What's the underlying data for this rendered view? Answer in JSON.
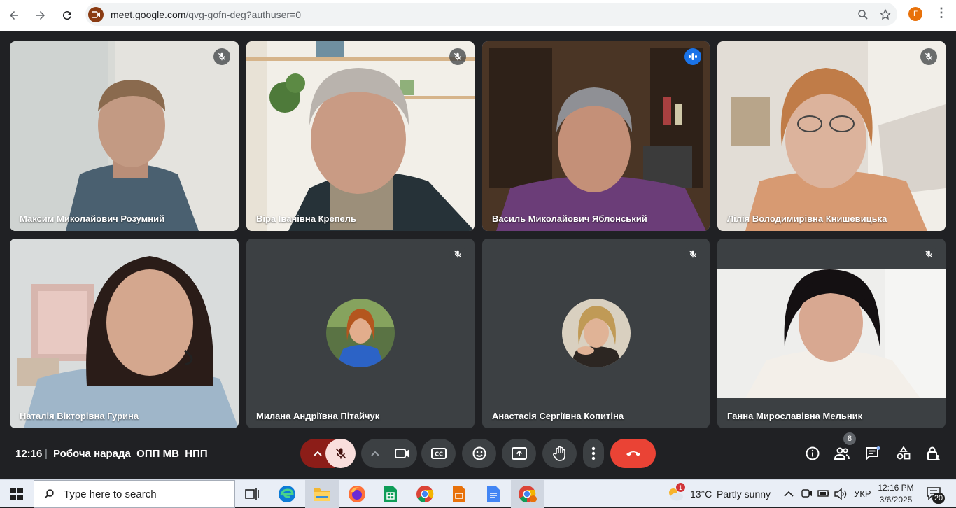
{
  "browser": {
    "url_host": "meet.google.com",
    "url_path": "/qvg-gofn-deg?authuser=0",
    "profile_initial": "Г"
  },
  "participants": [
    {
      "name": "Максим Миколайович Розумний",
      "muted": true
    },
    {
      "name": "Віра Іванівна Крепель",
      "muted": true
    },
    {
      "name": "Василь Миколайович Яблонський",
      "speaking": true
    },
    {
      "name": "Лілія Володимирівна Книшевицька",
      "muted": true
    },
    {
      "name": "Наталія Вікторівна Гурина",
      "muted": false
    },
    {
      "name": "Милана Андріївна Пітайчук",
      "muted": true
    },
    {
      "name": "Анастасія Сергіївна Копитіна",
      "muted": true
    },
    {
      "name": "Ганна Мирославівна Мельник",
      "muted": true
    }
  ],
  "meeting": {
    "time": "12:16",
    "separator": "|",
    "title": "Робоча нарада_ОПП МВ_НПП",
    "participant_count": "8"
  },
  "taskbar": {
    "search_placeholder": "Type here to search",
    "weather_temp": "13°C",
    "weather_desc": "Partly sunny",
    "weather_badge": "1",
    "language": "УКР",
    "clock_time": "12:16 PM",
    "clock_date": "3/6/2025",
    "notifications": "20"
  },
  "colors": {
    "meet_bg": "#202124",
    "tile_bg": "#3c4043",
    "end_call": "#ea4335",
    "mic_off": "#f9dedc",
    "mic_off_arrow": "#8c1d18",
    "active_border": "#8ab4f8"
  }
}
